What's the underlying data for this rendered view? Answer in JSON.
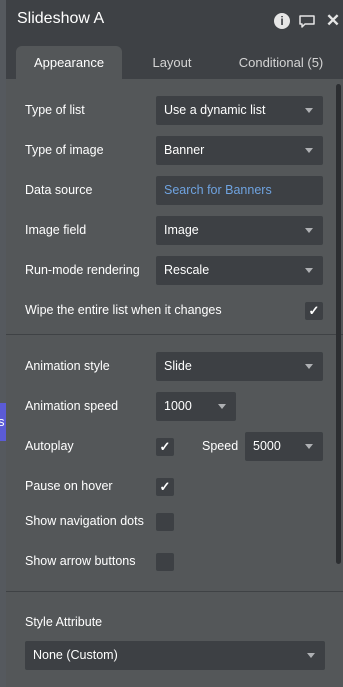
{
  "title": "Slideshow A",
  "tabs": [
    "Appearance",
    "Layout",
    "Conditional (5)"
  ],
  "fields": {
    "type_of_list": {
      "label": "Type of list",
      "value": "Use a dynamic list"
    },
    "type_of_image": {
      "label": "Type of image",
      "value": "Banner"
    },
    "data_source": {
      "label": "Data source",
      "value": "Search for Banners"
    },
    "image_field": {
      "label": "Image field",
      "value": "Image"
    },
    "run_mode": {
      "label": "Run-mode rendering",
      "value": "Rescale"
    },
    "wipe": {
      "label": "Wipe the entire list when it changes",
      "checked": true
    },
    "animation_style": {
      "label": "Animation style",
      "value": "Slide"
    },
    "animation_speed": {
      "label": "Animation speed",
      "value": "1000"
    },
    "autoplay": {
      "label": "Autoplay",
      "checked": true
    },
    "speed": {
      "label": "Speed",
      "value": "5000"
    },
    "pause_on_hover": {
      "label": "Pause on hover",
      "checked": true
    },
    "nav_dots": {
      "label": "Show navigation dots",
      "checked": false
    },
    "arrow_buttons": {
      "label": "Show arrow buttons",
      "checked": false
    },
    "style_attribute": {
      "label": "Style Attribute",
      "value": "None (Custom)"
    }
  },
  "side_fragment": "s",
  "colors": {
    "link": "#6fa3e0",
    "panel": "#545759",
    "accent_purple": "#5b5bd6"
  }
}
